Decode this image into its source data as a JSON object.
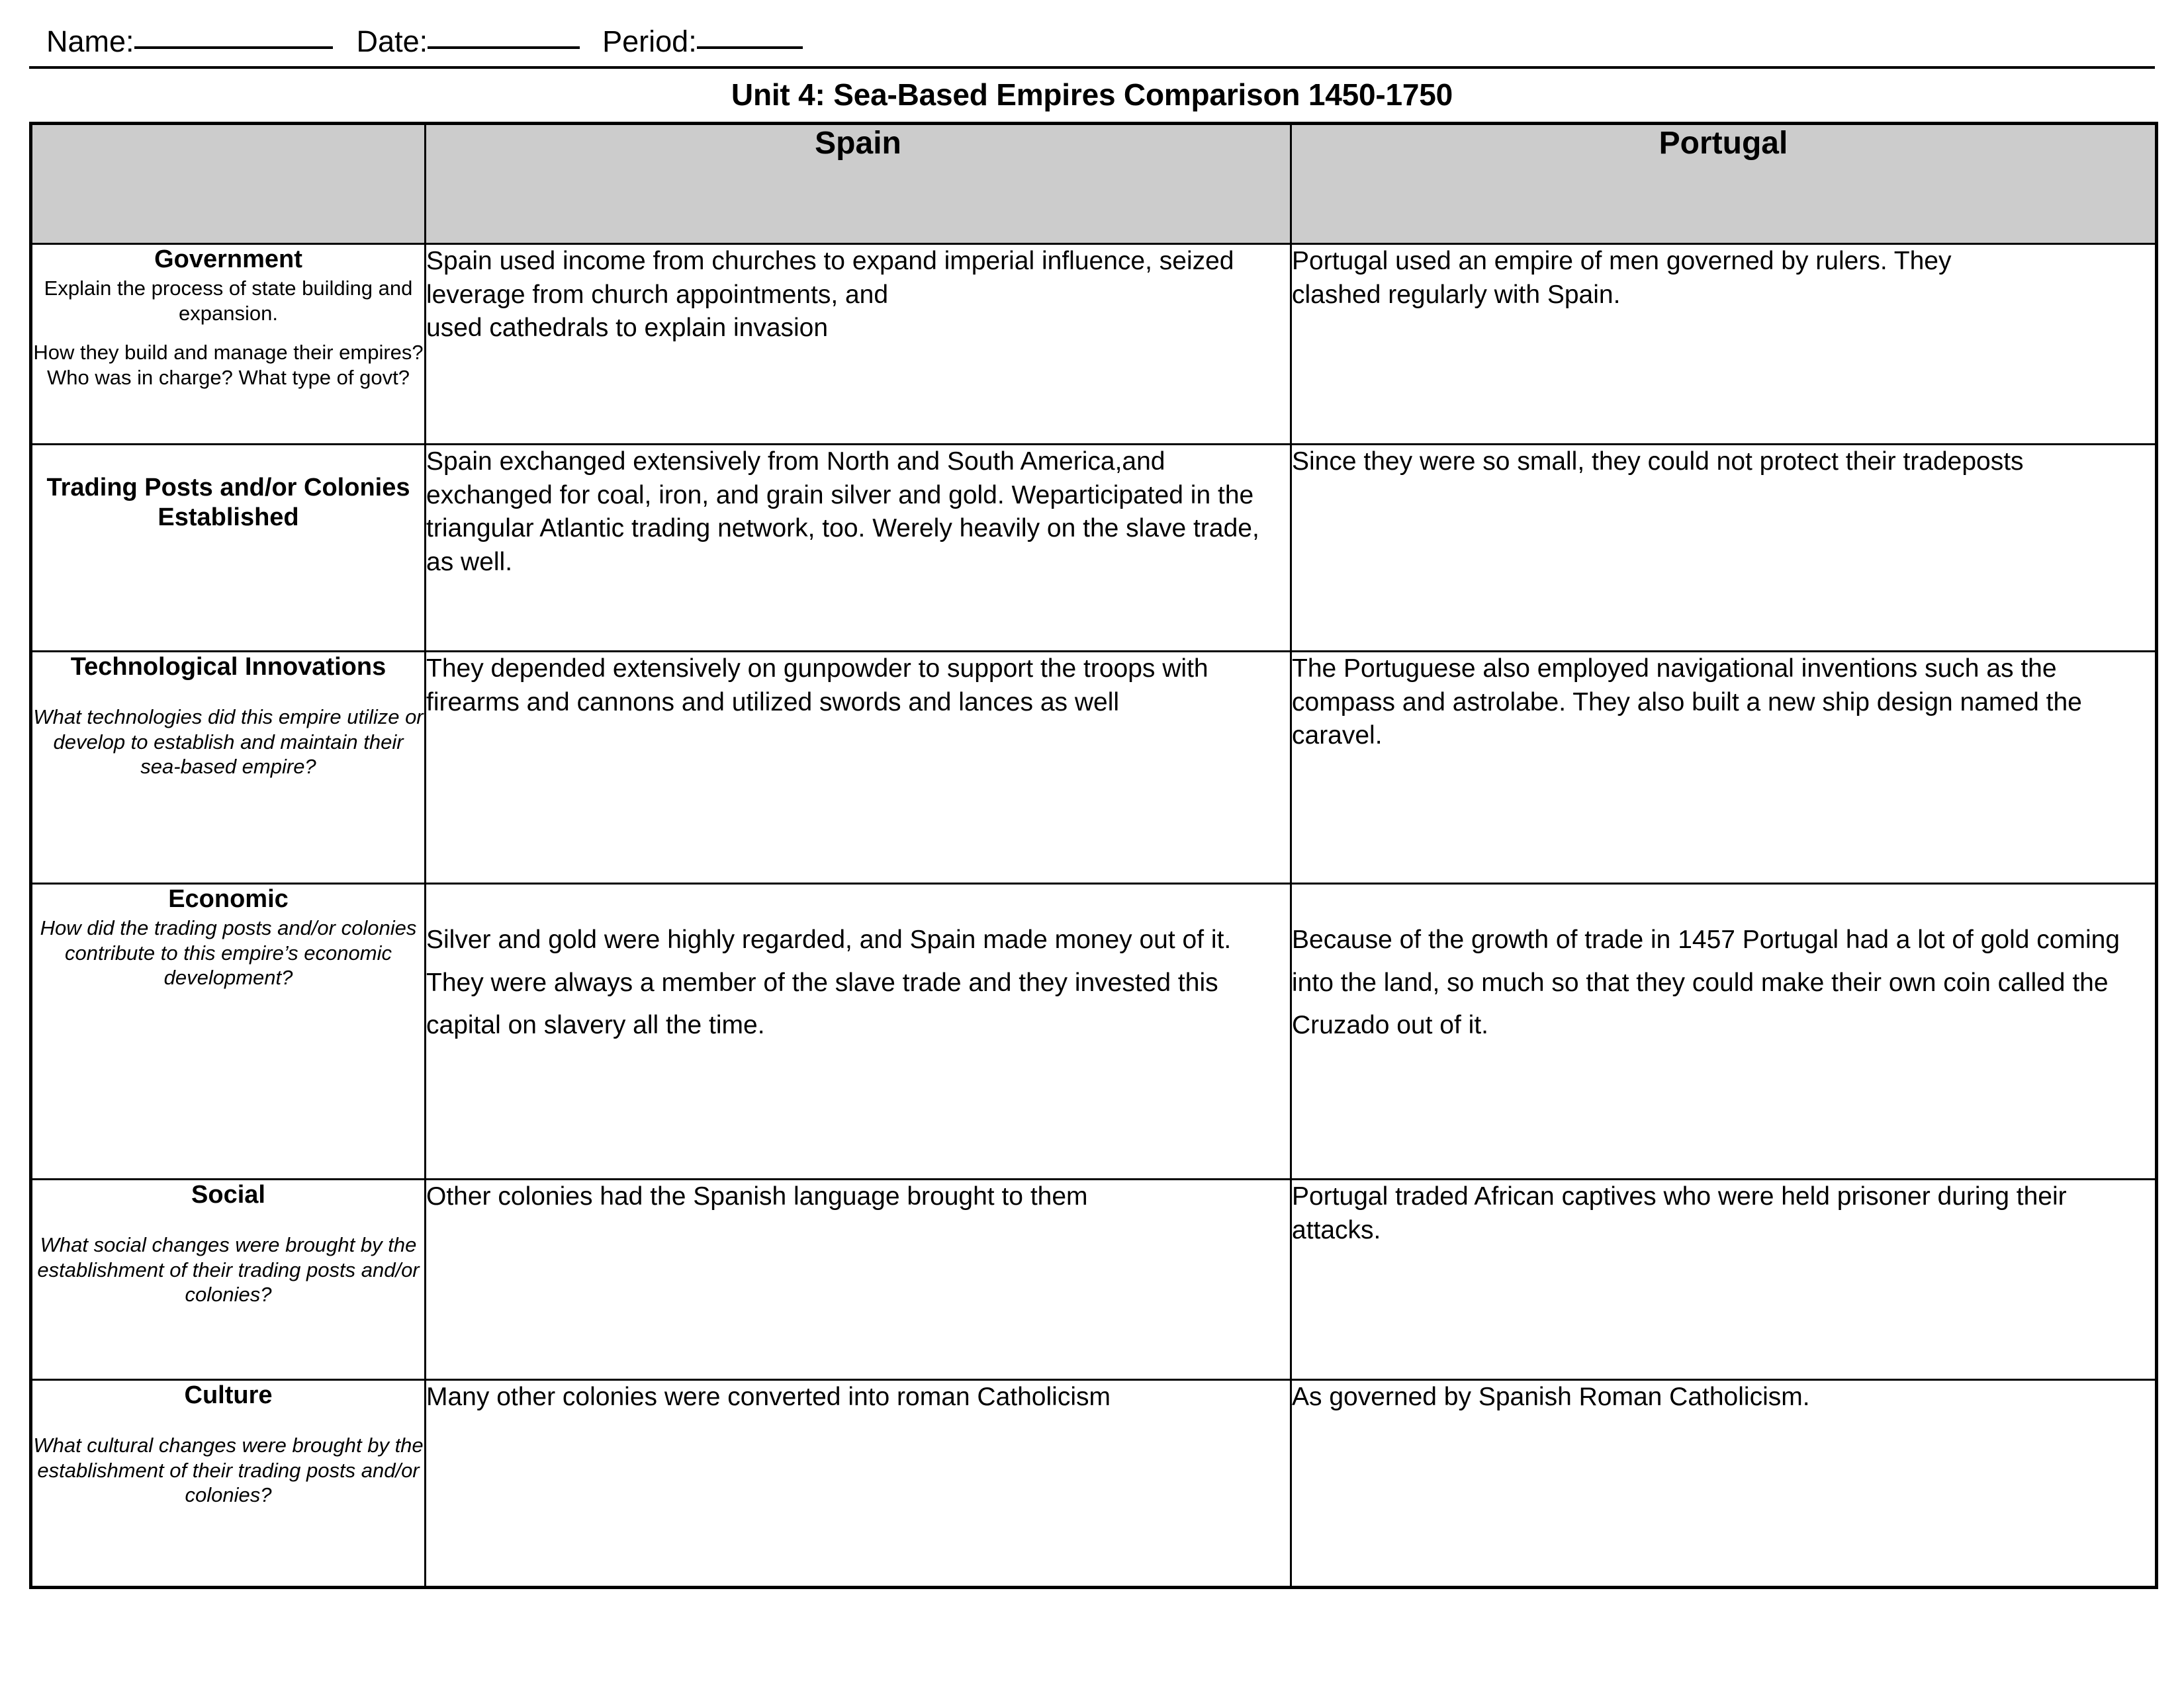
{
  "header_line": {
    "name_label": "Name:",
    "date_label": "Date:",
    "period_label": "Period:"
  },
  "title": "Unit 4: Sea-Based Empires Comparison 1450-1750",
  "table": {
    "header_bg": "#cccccc",
    "columns": [
      {
        "key": "category",
        "label": ""
      },
      {
        "key": "spain",
        "label": "Spain"
      },
      {
        "key": "portugal",
        "label": "Portugal"
      }
    ],
    "rows": [
      {
        "category": {
          "title": "Government",
          "sub1": "Explain the process of state building and expansion.",
          "sub2": "How they build and manage their empires? Who was in charge? What type of govt?",
          "italic": false
        },
        "spain": "Spain used income from churches to expand imperial influence, seized leverage from church appointments, and\nused cathedrals to explain invasion",
        "portugal": "Portugal used an empire of men governed by rulers. They\nclashed regularly with Spain."
      },
      {
        "category": {
          "title": "Trading Posts and/or Colonies Established",
          "sub1": "",
          "sub2": "",
          "italic": false
        },
        "spain": "Spain exchanged extensively from North and South America,and exchanged for coal, iron, and grain silver and gold. Weparticipated in the triangular Atlantic trading network, too. Werely heavily on the slave trade, as well.",
        "portugal": "Since they were so small, they could not protect their tradeposts"
      },
      {
        "category": {
          "title": "Technological Innovations",
          "sub1": "",
          "sub2": "What technologies did this empire utilize or develop to establish and maintain their sea-based empire?",
          "italic": true
        },
        "spain": "They depended extensively on gunpowder to support the troops with firearms and cannons and utilized swords and lances as well",
        "portugal": "The Portuguese also employed navigational inventions such as the compass and astrolabe. They also built a new ship design named the caravel."
      },
      {
        "category": {
          "title": "Economic",
          "sub1": "How did the trading posts and/or colonies contribute to this empire’s economic development?",
          "sub2": "",
          "italic": true
        },
        "spain": "Silver and gold were highly regarded, and Spain made money out of it. They were always a member of the slave trade and they invested this capital on slavery all the time.",
        "portugal": "Because of the growth of trade in 1457 Portugal had a lot of gold coming into the land, so much so that they could make their own coin called the Cruzado out of it."
      },
      {
        "category": {
          "title": "Social",
          "sub1": "",
          "sub2": "What social changes were brought by the establishment of their trading posts and/or colonies?",
          "italic": true
        },
        "spain": "Other colonies had the Spanish language brought to them",
        "portugal": "Portugal traded African captives who were held prisoner during their attacks."
      },
      {
        "category": {
          "title": "Culture",
          "sub1": "",
          "sub2": "What cultural changes were brought by the establishment of their trading posts and/or colonies?",
          "italic": true
        },
        "spain": "Many other colonies were converted into roman Catholicism",
        "portugal": "As governed by Spanish Roman Catholicism."
      }
    ]
  }
}
